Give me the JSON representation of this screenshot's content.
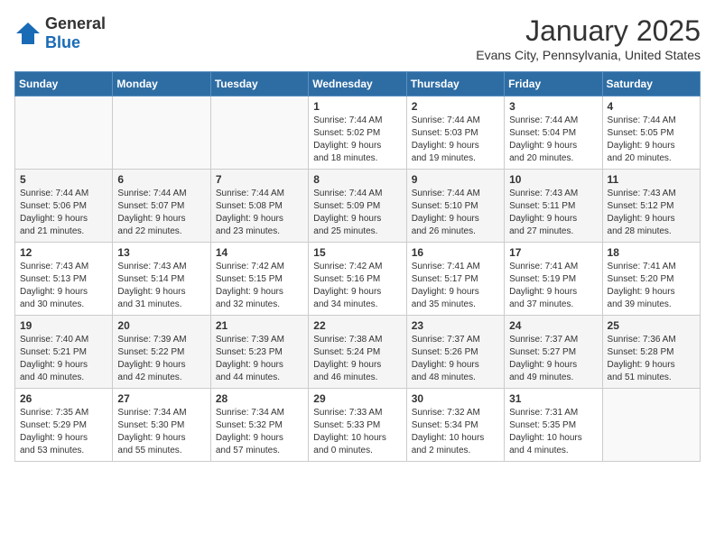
{
  "header": {
    "logo_general": "General",
    "logo_blue": "Blue",
    "month": "January 2025",
    "location": "Evans City, Pennsylvania, United States"
  },
  "weekdays": [
    "Sunday",
    "Monday",
    "Tuesday",
    "Wednesday",
    "Thursday",
    "Friday",
    "Saturday"
  ],
  "weeks": [
    [
      {
        "day": "",
        "details": ""
      },
      {
        "day": "",
        "details": ""
      },
      {
        "day": "",
        "details": ""
      },
      {
        "day": "1",
        "details": "Sunrise: 7:44 AM\nSunset: 5:02 PM\nDaylight: 9 hours\nand 18 minutes."
      },
      {
        "day": "2",
        "details": "Sunrise: 7:44 AM\nSunset: 5:03 PM\nDaylight: 9 hours\nand 19 minutes."
      },
      {
        "day": "3",
        "details": "Sunrise: 7:44 AM\nSunset: 5:04 PM\nDaylight: 9 hours\nand 20 minutes."
      },
      {
        "day": "4",
        "details": "Sunrise: 7:44 AM\nSunset: 5:05 PM\nDaylight: 9 hours\nand 20 minutes."
      }
    ],
    [
      {
        "day": "5",
        "details": "Sunrise: 7:44 AM\nSunset: 5:06 PM\nDaylight: 9 hours\nand 21 minutes."
      },
      {
        "day": "6",
        "details": "Sunrise: 7:44 AM\nSunset: 5:07 PM\nDaylight: 9 hours\nand 22 minutes."
      },
      {
        "day": "7",
        "details": "Sunrise: 7:44 AM\nSunset: 5:08 PM\nDaylight: 9 hours\nand 23 minutes."
      },
      {
        "day": "8",
        "details": "Sunrise: 7:44 AM\nSunset: 5:09 PM\nDaylight: 9 hours\nand 25 minutes."
      },
      {
        "day": "9",
        "details": "Sunrise: 7:44 AM\nSunset: 5:10 PM\nDaylight: 9 hours\nand 26 minutes."
      },
      {
        "day": "10",
        "details": "Sunrise: 7:43 AM\nSunset: 5:11 PM\nDaylight: 9 hours\nand 27 minutes."
      },
      {
        "day": "11",
        "details": "Sunrise: 7:43 AM\nSunset: 5:12 PM\nDaylight: 9 hours\nand 28 minutes."
      }
    ],
    [
      {
        "day": "12",
        "details": "Sunrise: 7:43 AM\nSunset: 5:13 PM\nDaylight: 9 hours\nand 30 minutes."
      },
      {
        "day": "13",
        "details": "Sunrise: 7:43 AM\nSunset: 5:14 PM\nDaylight: 9 hours\nand 31 minutes."
      },
      {
        "day": "14",
        "details": "Sunrise: 7:42 AM\nSunset: 5:15 PM\nDaylight: 9 hours\nand 32 minutes."
      },
      {
        "day": "15",
        "details": "Sunrise: 7:42 AM\nSunset: 5:16 PM\nDaylight: 9 hours\nand 34 minutes."
      },
      {
        "day": "16",
        "details": "Sunrise: 7:41 AM\nSunset: 5:17 PM\nDaylight: 9 hours\nand 35 minutes."
      },
      {
        "day": "17",
        "details": "Sunrise: 7:41 AM\nSunset: 5:19 PM\nDaylight: 9 hours\nand 37 minutes."
      },
      {
        "day": "18",
        "details": "Sunrise: 7:41 AM\nSunset: 5:20 PM\nDaylight: 9 hours\nand 39 minutes."
      }
    ],
    [
      {
        "day": "19",
        "details": "Sunrise: 7:40 AM\nSunset: 5:21 PM\nDaylight: 9 hours\nand 40 minutes."
      },
      {
        "day": "20",
        "details": "Sunrise: 7:39 AM\nSunset: 5:22 PM\nDaylight: 9 hours\nand 42 minutes."
      },
      {
        "day": "21",
        "details": "Sunrise: 7:39 AM\nSunset: 5:23 PM\nDaylight: 9 hours\nand 44 minutes."
      },
      {
        "day": "22",
        "details": "Sunrise: 7:38 AM\nSunset: 5:24 PM\nDaylight: 9 hours\nand 46 minutes."
      },
      {
        "day": "23",
        "details": "Sunrise: 7:37 AM\nSunset: 5:26 PM\nDaylight: 9 hours\nand 48 minutes."
      },
      {
        "day": "24",
        "details": "Sunrise: 7:37 AM\nSunset: 5:27 PM\nDaylight: 9 hours\nand 49 minutes."
      },
      {
        "day": "25",
        "details": "Sunrise: 7:36 AM\nSunset: 5:28 PM\nDaylight: 9 hours\nand 51 minutes."
      }
    ],
    [
      {
        "day": "26",
        "details": "Sunrise: 7:35 AM\nSunset: 5:29 PM\nDaylight: 9 hours\nand 53 minutes."
      },
      {
        "day": "27",
        "details": "Sunrise: 7:34 AM\nSunset: 5:30 PM\nDaylight: 9 hours\nand 55 minutes."
      },
      {
        "day": "28",
        "details": "Sunrise: 7:34 AM\nSunset: 5:32 PM\nDaylight: 9 hours\nand 57 minutes."
      },
      {
        "day": "29",
        "details": "Sunrise: 7:33 AM\nSunset: 5:33 PM\nDaylight: 10 hours\nand 0 minutes."
      },
      {
        "day": "30",
        "details": "Sunrise: 7:32 AM\nSunset: 5:34 PM\nDaylight: 10 hours\nand 2 minutes."
      },
      {
        "day": "31",
        "details": "Sunrise: 7:31 AM\nSunset: 5:35 PM\nDaylight: 10 hours\nand 4 minutes."
      },
      {
        "day": "",
        "details": ""
      }
    ]
  ]
}
